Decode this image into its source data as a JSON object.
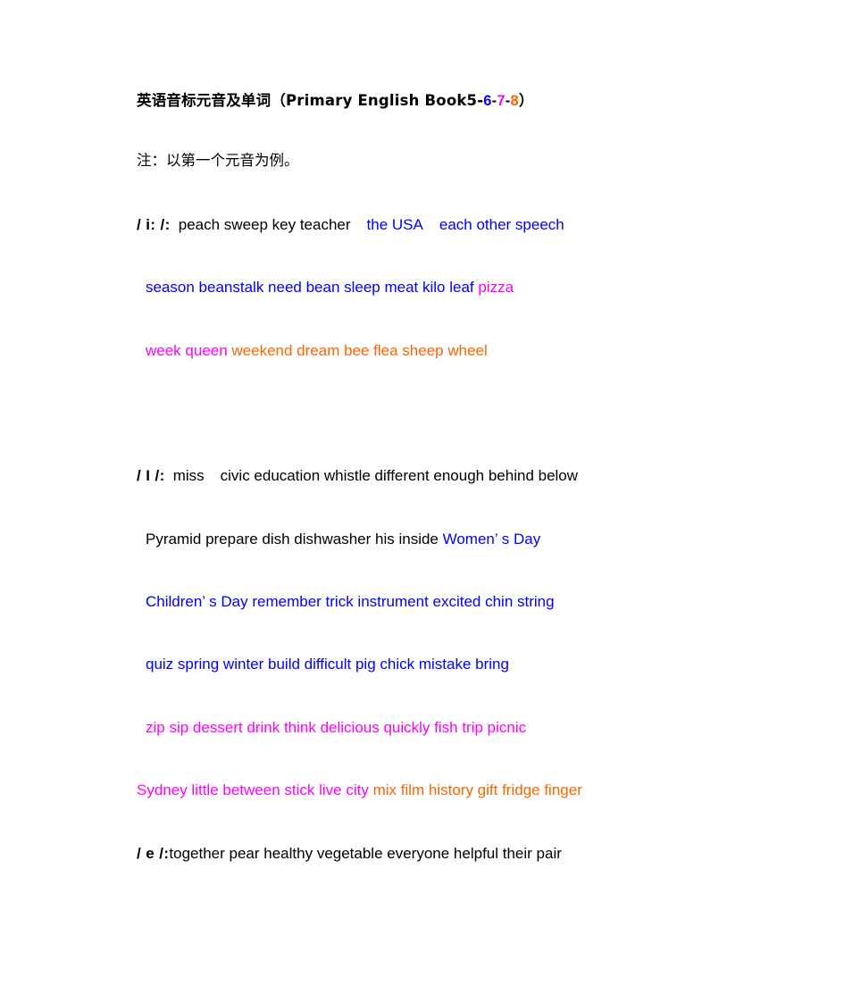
{
  "document": {
    "title": {
      "cjk_part": "英语音标元音及单词",
      "paren_open": "（Primary English Book5-",
      "num_6": "6",
      "dash_1": "-",
      "num_7": "7",
      "dash_2": "-",
      "num_8": "8",
      "paren_close": "）"
    },
    "note": "注：以第一个元音为例。",
    "colors": {
      "black": "#000000",
      "blue": "#0000ff",
      "magenta": "#ff00ff",
      "orange": "#f96500"
    },
    "sections": [
      {
        "symbol": "/ i: /:",
        "lines": [
          {
            "indent": "none",
            "runs": [
              {
                "text": "peach sweep key teacher",
                "color": "black"
              },
              {
                "text": "the USA",
                "color": "blue"
              },
              {
                "text": "each other speech",
                "color": "blue"
              }
            ]
          },
          {
            "indent": "small",
            "runs": [
              {
                "text": "season  beanstalk need bean sleep meat kilo leaf ",
                "color": "blue"
              },
              {
                "text": "pizza",
                "color": "magenta"
              }
            ]
          },
          {
            "indent": "small",
            "runs": [
              {
                "text": "week queen ",
                "color": "magenta"
              },
              {
                "text": "weekend dream bee flea sheep wheel",
                "color": "orange"
              }
            ]
          }
        ]
      },
      {
        "symbol": "/ I /:",
        "lines": [
          {
            "indent": "none",
            "runs": [
              {
                "text": "miss",
                "color": "black"
              },
              {
                "text": "civic education whistle different enough behind below",
                "color": "black"
              }
            ]
          },
          {
            "indent": "small",
            "runs": [
              {
                "text": "Pyramid prepare dish dishwasher his inside ",
                "color": "black"
              },
              {
                "text": "Women’  s Day",
                "color": "blue"
              }
            ]
          },
          {
            "indent": "small",
            "runs": [
              {
                "text": "Children’  s Day remember trick instrument excited chin string",
                "color": "blue"
              }
            ]
          },
          {
            "indent": "small",
            "runs": [
              {
                "text": "quiz spring winter build difficult pig chick mistake bring",
                "color": "blue"
              }
            ]
          },
          {
            "indent": "small",
            "runs": [
              {
                "text": "zip sip dessert drink think delicious quickly fish trip picnic",
                "color": "magenta"
              }
            ]
          },
          {
            "indent": "flush",
            "runs": [
              {
                "text": "Sydney little between stick live city ",
                "color": "magenta"
              },
              {
                "text": "mix film history gift fridge finger",
                "color": "orange"
              }
            ]
          }
        ]
      },
      {
        "symbol": "/ e /:",
        "lines": [
          {
            "indent": "none",
            "runs": [
              {
                "text": "together pear healthy vegetable everyone helpful their pair",
                "color": "black"
              }
            ]
          }
        ]
      }
    ]
  }
}
